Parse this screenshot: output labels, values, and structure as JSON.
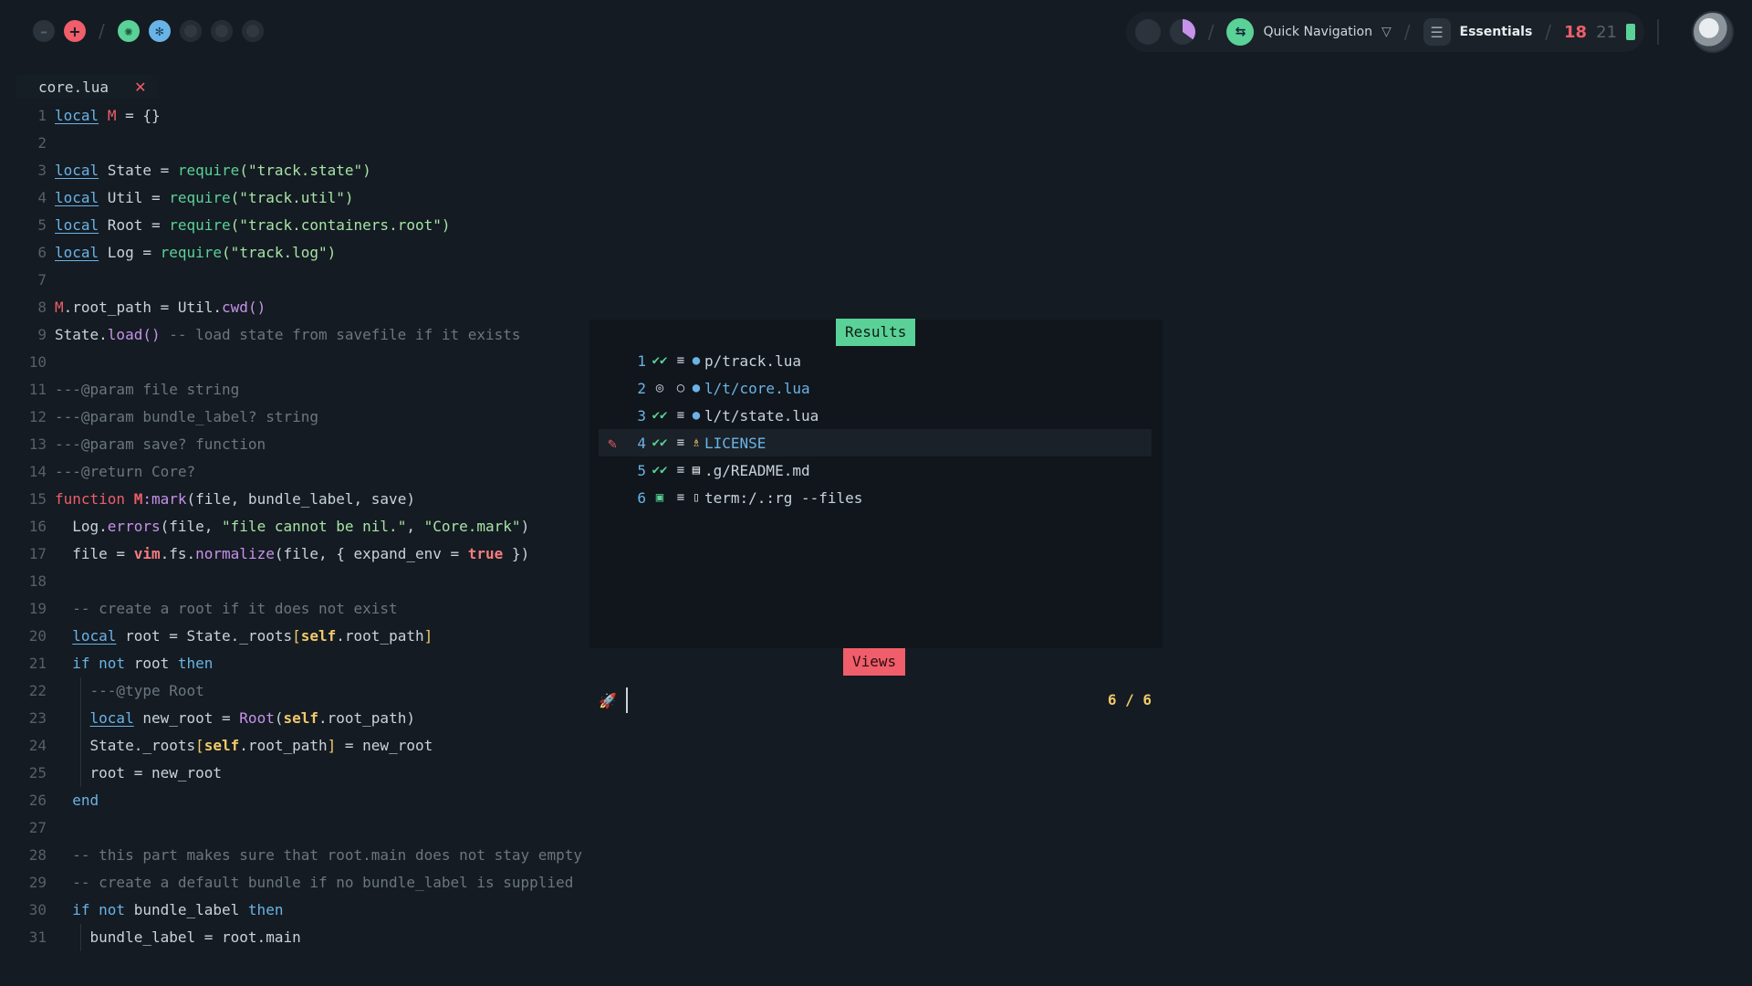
{
  "topbar": {
    "minimize_glyph": "–",
    "add_glyph": "+",
    "quick_nav_label": "Quick Navigation",
    "menu_label": "Essentials",
    "clock_hour": "18",
    "clock_min": "21"
  },
  "tab": {
    "filename": "core.lua",
    "close_glyph": "✕"
  },
  "editor": {
    "lines": [
      {
        "n": "1"
      },
      {
        "n": "2"
      },
      {
        "n": "3"
      },
      {
        "n": "4"
      },
      {
        "n": "5"
      },
      {
        "n": "6"
      },
      {
        "n": "7"
      },
      {
        "n": "8"
      },
      {
        "n": "9"
      },
      {
        "n": "10"
      },
      {
        "n": "11"
      },
      {
        "n": "12"
      },
      {
        "n": "13"
      },
      {
        "n": "14"
      },
      {
        "n": "15"
      },
      {
        "n": "16"
      },
      {
        "n": "17"
      },
      {
        "n": "18"
      },
      {
        "n": "19"
      },
      {
        "n": "20"
      },
      {
        "n": "21"
      },
      {
        "n": "22"
      },
      {
        "n": "23"
      },
      {
        "n": "24"
      },
      {
        "n": "25"
      },
      {
        "n": "26"
      },
      {
        "n": "27"
      },
      {
        "n": "28"
      },
      {
        "n": "29"
      },
      {
        "n": "30"
      },
      {
        "n": "31"
      }
    ],
    "code": {
      "l1_a": "local",
      "l1_b": "M",
      "l1_c": " = {}",
      "l3_a": "local",
      "l3_b": " State = ",
      "l3_c": "require",
      "l3_d": "(\"track.state\")",
      "l4_a": "local",
      "l4_b": " Util = ",
      "l4_c": "require",
      "l4_d": "(\"track.util\")",
      "l5_a": "local",
      "l5_b": " Root = ",
      "l5_c": "require",
      "l5_d": "(\"track.containers.root\")",
      "l6_a": "local",
      "l6_b": " Log = ",
      "l6_c": "require",
      "l6_d": "(\"track.log\")",
      "l8_a": "M",
      "l8_b": ".root_path = Util.",
      "l8_c": "cwd",
      "l8_d": "()",
      "l9_a": "State.",
      "l9_b": "load",
      "l9_c": "()",
      "l9_d": " -- load state from savefile if it exists",
      "l11": "---@param file string",
      "l12": "---@param bundle_label? string",
      "l13": "---@param save? function",
      "l14": "---@return Core?",
      "l15_a": "function",
      "l15_b": " M",
      "l15_c": ":mark",
      "l15_d": "(file, bundle_label, save)",
      "l16_a": "  Log.",
      "l16_b": "errors",
      "l16_c": "(file, ",
      "l16_d": "\"file cannot be nil.\"",
      "l16_e": ", ",
      "l16_f": "\"Core.mark\"",
      "l16_g": ")",
      "l17_a": "  file = ",
      "l17_b": "vim",
      "l17_c": ".fs.",
      "l17_d": "normalize",
      "l17_e": "(file, { expand_env = ",
      "l17_f": "true",
      "l17_g": " })",
      "l19": "  -- create a root if it does not exist",
      "l20_a": "  ",
      "l20_b": "local",
      "l20_c": " root = State._roots",
      "l20_d": "[",
      "l20_e": "self",
      "l20_f": ".root_path",
      "l20_g": "]",
      "l21_a": "  if not",
      "l21_b": " root ",
      "l21_c": "then",
      "l22": "    ---@type Root",
      "l23_a": "    ",
      "l23_b": "local",
      "l23_c": " new_root = ",
      "l23_d": "Root",
      "l23_e": "(",
      "l23_f": "self",
      "l23_g": ".root_path)",
      "l24_a": "    State._roots",
      "l24_b": "[",
      "l24_c": "self",
      "l24_d": ".root_path",
      "l24_e": "]",
      "l24_f": " = new_root",
      "l25": "    root = new_root",
      "l26": "  end",
      "l28": "  -- this part makes sure that root.main does not stay empty",
      "l29": "  -- create a default bundle if no bundle_label is supplied",
      "l30_a": "  if not",
      "l30_b": " bundle_label ",
      "l30_c": "then",
      "l31": "    bundle_label = root.main"
    }
  },
  "results": {
    "title": "Results",
    "items": [
      {
        "num": "1",
        "state": "✔✔",
        "mark": "≡",
        "icon": "●",
        "name": "p/track.lua"
      },
      {
        "num": "2",
        "state": "◎",
        "mark": "○",
        "icon": "●",
        "name": "l/t/core.lua"
      },
      {
        "num": "3",
        "state": "✔✔",
        "mark": "≡",
        "icon": "●",
        "name": "l/t/state.lua"
      },
      {
        "num": "4",
        "state": "✔✔",
        "mark": "≡",
        "icon": "♗",
        "name": "LICENSE",
        "pen": "✎"
      },
      {
        "num": "5",
        "state": "✔✔",
        "mark": "≡",
        "icon": "▤",
        "name": ".g/README.md"
      },
      {
        "num": "6",
        "state": "▣",
        "mark": "≡",
        "icon": "▯",
        "name": "term:/.:rg --files"
      }
    ]
  },
  "views": {
    "title": "Views",
    "rocket": "🚀",
    "count": "6 / 6"
  }
}
